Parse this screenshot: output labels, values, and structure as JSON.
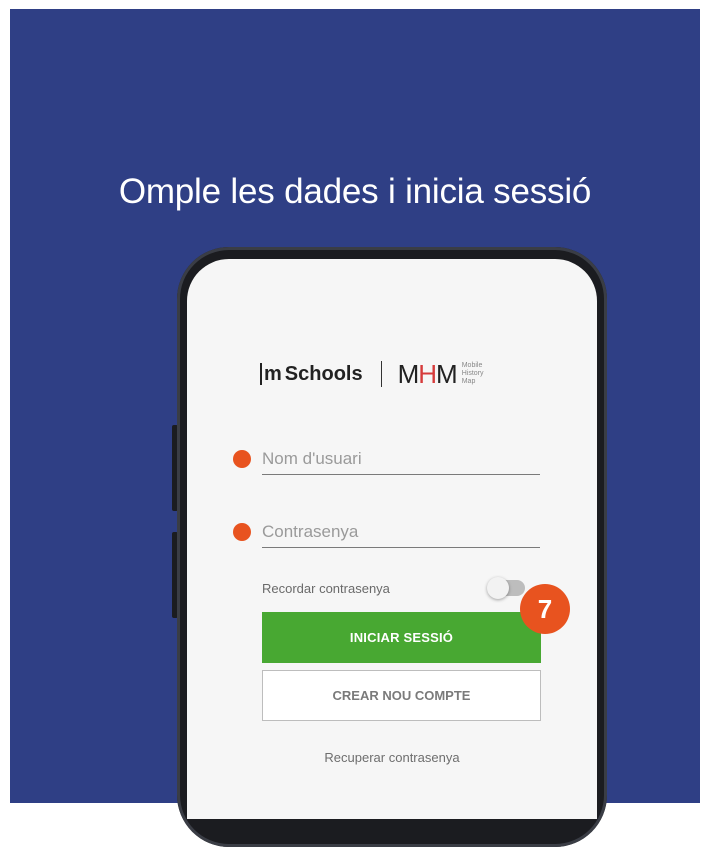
{
  "headline": "Omple les dades i inicia sessió",
  "logos": {
    "mschools_m": "m",
    "mschools_rest": "Schools",
    "mhm_M1": "M",
    "mhm_H": "H",
    "mhm_M2": "M",
    "mhm_sub": [
      "Mobile",
      "History",
      "Map"
    ]
  },
  "form": {
    "username_placeholder": "Nom d'usuari",
    "password_placeholder": "Contrasenya",
    "remember_label": "Recordar contrasenya",
    "remember_on": false,
    "login_label": "INICIAR SESSIÓ",
    "create_label": "CREAR NOU COMPTE",
    "recover_label": "Recuperar contrasenya"
  },
  "step_badge": "7",
  "colors": {
    "background": "#2f3f85",
    "accent_orange": "#e8531f",
    "login_green": "#48a832"
  }
}
